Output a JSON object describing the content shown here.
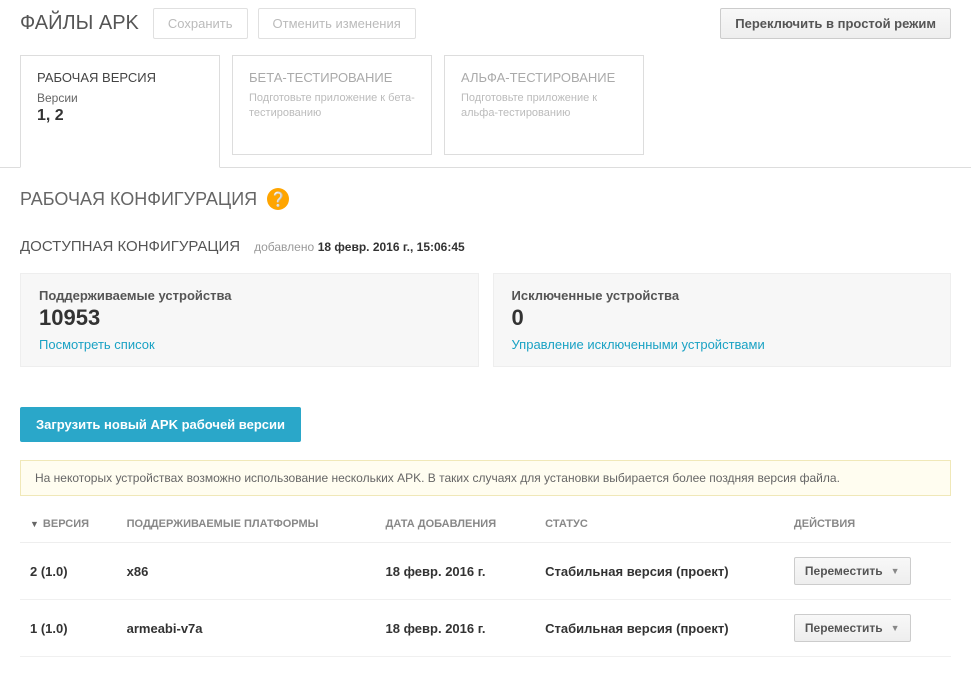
{
  "header": {
    "title": "ФАЙЛЫ APK",
    "save": "Сохранить",
    "cancel": "Отменить изменения",
    "switch_mode": "Переключить в простой режим"
  },
  "tabs": [
    {
      "title": "РАБОЧАЯ ВЕРСИЯ",
      "subtitle": "Версии",
      "versions": "1, 2",
      "desc": "",
      "active": true
    },
    {
      "title": "БЕТА-ТЕСТИРОВАНИЕ",
      "subtitle": "",
      "versions": "",
      "desc": "Подготовьте приложение к бета-тестированию",
      "active": false
    },
    {
      "title": "АЛЬФА-ТЕСТИРОВАНИЕ",
      "subtitle": "",
      "versions": "",
      "desc": "Подготовьте приложение к альфа-тестированию",
      "active": false
    }
  ],
  "work_config": {
    "title": "РАБОЧАЯ КОНФИГУРАЦИЯ"
  },
  "available": {
    "title": "ДОСТУПНАЯ КОНФИГУРАЦИЯ",
    "added_label": "добавлено",
    "added_date": "18 февр. 2016 г., 15:06:45"
  },
  "cards": {
    "supported": {
      "label": "Поддерживаемые устройства",
      "value": "10953",
      "link": "Посмотреть список"
    },
    "excluded": {
      "label": "Исключенные устройства",
      "value": "0",
      "link": "Управление исключенными устройствами"
    }
  },
  "upload_btn": "Загрузить новый APK рабочей версии",
  "notice": "На некоторых устройствах возможно использование нескольких APK. В таких случаях для установки выбирается более поздняя версия файла.",
  "table": {
    "headers": {
      "version": "ВЕРСИЯ",
      "platforms": "ПОДДЕРЖИВАЕМЫЕ ПЛАТФОРМЫ",
      "date": "ДАТА ДОБАВЛЕНИЯ",
      "status": "СТАТУС",
      "actions": "ДЕЙСТВИЯ"
    },
    "move_label": "Переместить",
    "rows": [
      {
        "version": "2 (1.0)",
        "platforms": "x86",
        "date": "18 февр. 2016 г.",
        "status": "Стабильная версия (проект)"
      },
      {
        "version": "1 (1.0)",
        "platforms": "armeabi-v7a",
        "date": "18 февр. 2016 г.",
        "status": "Стабильная версия (проект)"
      }
    ]
  }
}
